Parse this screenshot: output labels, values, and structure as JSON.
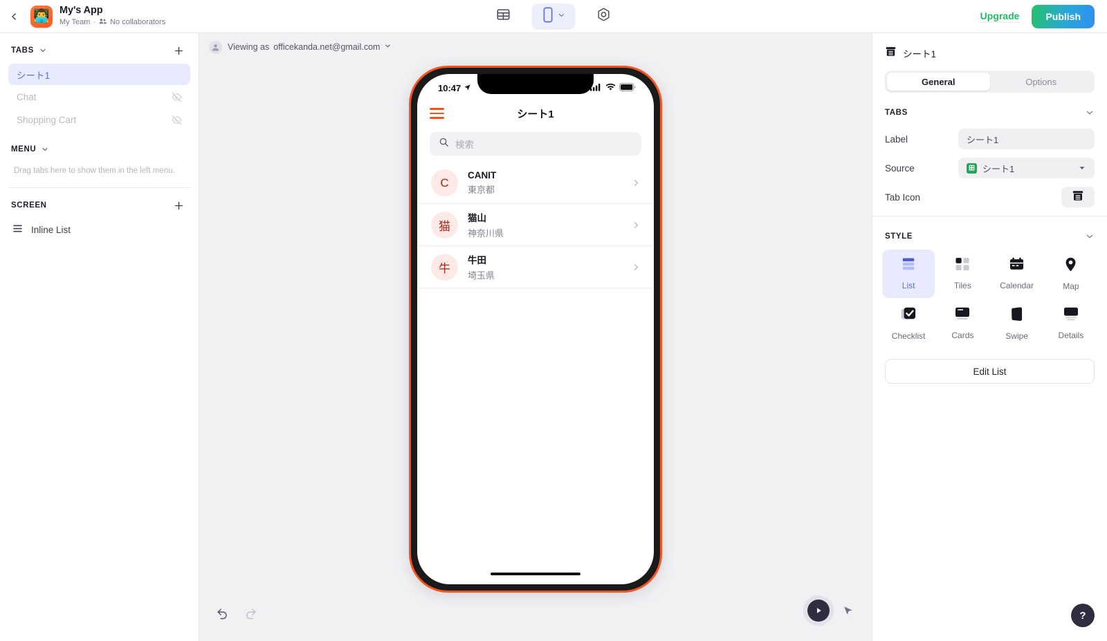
{
  "topbar": {
    "back_icon": "chevron-left-icon",
    "app_logo_glyph": "👨‍💻",
    "app_title": "My's App",
    "team": "My Team",
    "separator": "·",
    "collaborators": "No collaborators",
    "tools": {
      "table_icon": "table-icon",
      "device_icon": "phone-icon",
      "device_chevron": "chevron-down-icon",
      "settings_icon": "hexagon-settings-icon"
    },
    "upgrade_label": "Upgrade",
    "publish_label": "Publish",
    "publish_color": "#2aa6d8",
    "upgrade_color": "#22bb66"
  },
  "sidebar": {
    "tabs_section": {
      "title": "TABS",
      "chevron": "chevron-down-icon",
      "add_icon": "plus-icon",
      "items": [
        {
          "label": "シート1",
          "active": true,
          "hidden": false
        },
        {
          "label": "Chat",
          "active": false,
          "hidden": true
        },
        {
          "label": "Shopping Cart",
          "active": false,
          "hidden": true
        }
      ]
    },
    "menu_section": {
      "title": "MENU",
      "chevron": "chevron-down-icon",
      "hint": "Drag tabs here to show them in the left menu."
    },
    "screen_section": {
      "title": "SCREEN",
      "add_icon": "plus-icon",
      "items": [
        {
          "label": "Inline List",
          "icon": "list-icon"
        }
      ]
    }
  },
  "canvas": {
    "viewing_prefix": "Viewing as",
    "viewing_email": "officekanda.net@gmail.com",
    "viewing_chevron": "chevron-down-icon",
    "avatar_icon": "user-avatar-icon",
    "undo_icon": "undo-icon",
    "redo_icon": "redo-icon",
    "play_icon": "play-icon",
    "cursor_icon": "cursor-arrow-icon"
  },
  "phone": {
    "status": {
      "time": "10:47",
      "location_icon": "location-arrow-icon",
      "signal_icon": "cellular-signal-icon",
      "wifi_icon": "wifi-icon",
      "battery_icon": "battery-icon"
    },
    "nav": {
      "menu_icon": "hamburger-menu-icon",
      "title": "シート1",
      "accent_color": "#f4541f"
    },
    "search": {
      "icon": "search-icon",
      "placeholder": "検索",
      "value": ""
    },
    "list": [
      {
        "initial": "C",
        "title": "CANIT",
        "subtitle": "東京都",
        "chevron": "chevron-right-icon"
      },
      {
        "initial": "猫",
        "title": "猫山",
        "subtitle": "神奈川県",
        "chevron": "chevron-right-icon"
      },
      {
        "initial": "牛",
        "title": "牛田",
        "subtitle": "埼玉県",
        "chevron": "chevron-right-icon"
      }
    ]
  },
  "right_panel": {
    "header_icon": "archive-box-icon",
    "header_title": "シート1",
    "tabs": [
      {
        "label": "General",
        "active": true
      },
      {
        "label": "Options",
        "active": false
      }
    ],
    "tabs_group": {
      "title": "TABS",
      "chevron": "chevron-down-icon",
      "fields": [
        {
          "label": "Label",
          "value": "シート1",
          "type": "text"
        },
        {
          "label": "Source",
          "value": "シート1",
          "type": "select",
          "icon": "google-sheets-icon",
          "chevron": "chevron-down-icon"
        },
        {
          "label": "Tab Icon",
          "value": "",
          "type": "icon-button",
          "icon": "archive-box-icon"
        }
      ]
    },
    "style_group": {
      "title": "STYLE",
      "chevron": "chevron-down-icon",
      "options": [
        {
          "label": "List",
          "icon": "list-style-icon",
          "active": true
        },
        {
          "label": "Tiles",
          "icon": "tiles-style-icon",
          "active": false
        },
        {
          "label": "Calendar",
          "icon": "calendar-style-icon",
          "active": false
        },
        {
          "label": "Map",
          "icon": "map-pin-style-icon",
          "active": false
        },
        {
          "label": "Checklist",
          "icon": "checklist-style-icon",
          "active": false
        },
        {
          "label": "Cards",
          "icon": "cards-style-icon",
          "active": false
        },
        {
          "label": "Swipe",
          "icon": "swipe-style-icon",
          "active": false
        },
        {
          "label": "Details",
          "icon": "details-style-icon",
          "active": false
        }
      ]
    },
    "edit_button": "Edit List",
    "accent_color": "#5b6ef0"
  },
  "help": {
    "label": "?",
    "icon": "help-icon"
  }
}
